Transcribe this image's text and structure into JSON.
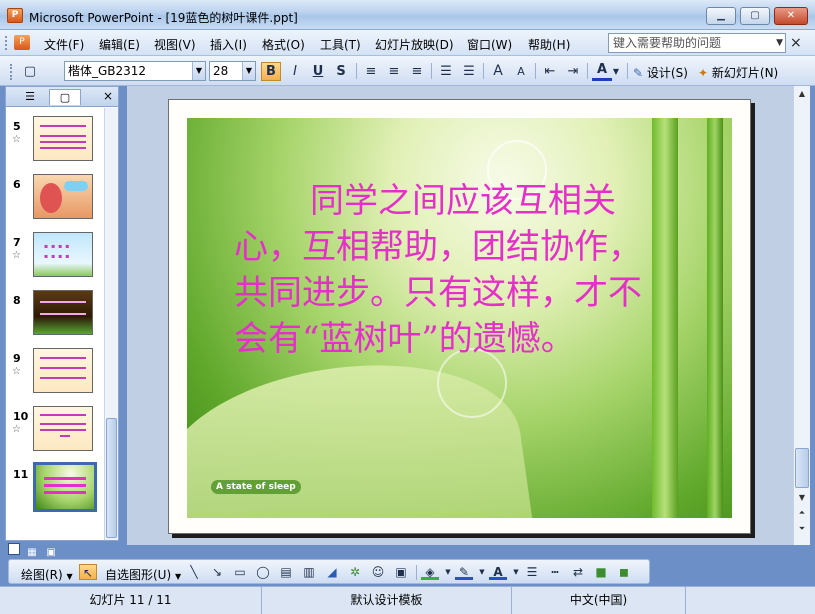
{
  "window": {
    "title": "Microsoft PowerPoint - [19蓝色的树叶课件.ppt]",
    "app_icon_glyph": "P",
    "minimize_glyph": "▁",
    "maximize_glyph": "▢",
    "close_glyph": "✕"
  },
  "menu": {
    "items": [
      "文件(F)",
      "编辑(E)",
      "视图(V)",
      "插入(I)",
      "格式(O)",
      "工具(T)",
      "幻灯片放映(D)",
      "窗口(W)",
      "帮助(H)"
    ],
    "help_placeholder": "键入需要帮助的问题",
    "close_glyph": "×"
  },
  "toolbar": {
    "font_name": "楷体_GB2312",
    "font_size": "28",
    "bold": "B",
    "italic": "I",
    "underline": "U",
    "shadow": "S",
    "design_label": "设计(S)",
    "new_slide_label": "新幻灯片(N)",
    "increase_font": "A",
    "decrease_font": "A",
    "font_color": "A"
  },
  "left_pane": {
    "tabs": [
      "outline",
      "slides"
    ],
    "slides": [
      {
        "number": "5",
        "has_animation": true
      },
      {
        "number": "6",
        "has_animation": false
      },
      {
        "number": "7",
        "has_animation": true
      },
      {
        "number": "8",
        "has_animation": false
      },
      {
        "number": "9",
        "has_animation": true
      },
      {
        "number": "10",
        "has_animation": true
      },
      {
        "number": "11",
        "has_animation": false,
        "selected": true
      }
    ],
    "close_glyph": "×"
  },
  "slide": {
    "text": "同学之间应该互相关心，互相帮助，团结协作，共同进步。只有这样，才不会有“蓝树叶”的遗憾。",
    "text_color": "#e52fc9",
    "logo_text": "A state of sleep"
  },
  "drawing_toolbar": {
    "draw_label": "绘图(R)",
    "autoshapes_label": "自选图形(U)"
  },
  "statusbar": {
    "slide_position": "幻灯片 11 / 11",
    "template": "默认设计模板",
    "language": "中文(中国)"
  },
  "colors": {
    "accent": "#3d69ad",
    "title_bar": "#b9d1ee",
    "slide_text": "#e52fc9"
  }
}
